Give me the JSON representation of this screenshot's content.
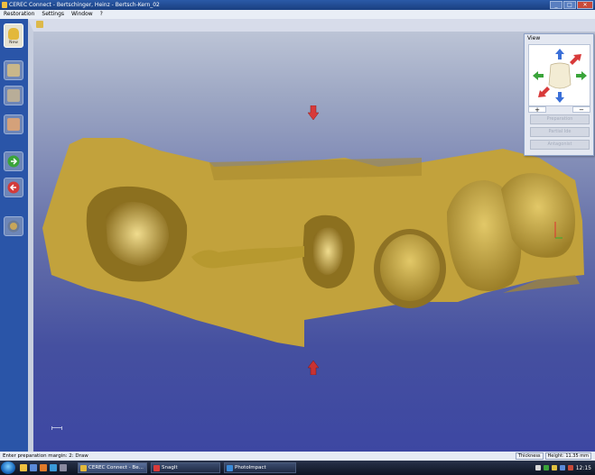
{
  "window": {
    "title": "CEREC Connect - Bertschinger, Heinz - Bertsch-Kern_02",
    "minimize": "_",
    "maximize": "□",
    "close": "✕"
  },
  "menu": [
    "Restoration",
    "Settings",
    "Window",
    "?"
  ],
  "sidebar": {
    "new_label": "New",
    "buttons": [
      "scan-icon",
      "model-icon",
      "design-icon",
      "next-icon",
      "back-icon",
      "globe-icon"
    ]
  },
  "view_panel": {
    "title": "View",
    "zoom_in": "+",
    "zoom_out": "−",
    "buttons": [
      "Preparation",
      "Partial Ide",
      "Antagonist"
    ]
  },
  "status": {
    "text": "Enter preparation margin: 2:  Draw",
    "thickness": "Thickness",
    "height": "Height: 11.35 mm"
  },
  "taskbar": {
    "tasks": [
      "CEREC Connect - Be...",
      "SnagIt",
      "PhotoImpact"
    ],
    "clock": "12:15"
  },
  "colors": {
    "model": "#c9a93e",
    "arrow": "#d83a3a",
    "sidebar": "#2a55a8"
  }
}
